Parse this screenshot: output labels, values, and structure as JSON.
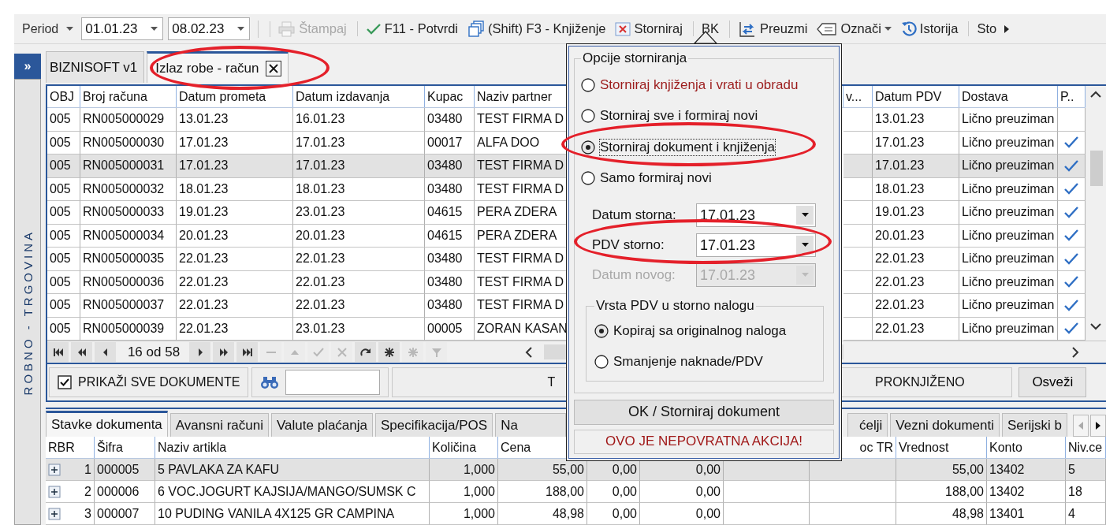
{
  "toolbar": {
    "period_label": "Period",
    "date_from": "01.01.23",
    "date_to": "08.02.23",
    "buttons": [
      {
        "kind": "print",
        "label": "Štampaj",
        "disabled": true,
        "separator_before": true,
        "dropdown": false
      },
      {
        "kind": "check",
        "label": "F11 - Potvrdi",
        "disabled": false,
        "separator_before": true,
        "dropdown": false
      },
      {
        "kind": "copy",
        "label": "(Shift) F3 - Knjiženje",
        "disabled": false,
        "separator_before": false,
        "dropdown": false
      },
      {
        "kind": "cancel",
        "label": "Storniraj",
        "disabled": false,
        "separator_before": false,
        "dropdown": false
      },
      {
        "kind": "text",
        "label": "BK",
        "disabled": false,
        "separator_before": true,
        "dropdown": false
      },
      {
        "kind": "download",
        "label": "Preuzmi",
        "disabled": false,
        "separator_before": true,
        "dropdown": false
      },
      {
        "kind": "tag",
        "label": "Označi",
        "disabled": false,
        "separator_before": false,
        "dropdown": true
      },
      {
        "kind": "history",
        "label": "Istorija",
        "disabled": false,
        "separator_before": false,
        "dropdown": false
      },
      {
        "kind": "text",
        "label": "Sto",
        "disabled": false,
        "separator_before": true,
        "dropdown": false
      }
    ]
  },
  "side_panel": {
    "expand_button": "»",
    "label": "ROBNO - TRGOVINA"
  },
  "tabs": [
    {
      "label": "BIZNISOFT v1",
      "selected": false,
      "closable": false
    },
    {
      "label": "Izlaz robe - račun",
      "selected": true,
      "closable": true
    }
  ],
  "documents_table": {
    "columns": [
      "OBJ",
      "Broj računa",
      "Datum prometa",
      "Datum izdavanja",
      "Kupac",
      "Naziv partner",
      null,
      "v...",
      "Datum PDV",
      "Dostava",
      "P.."
    ],
    "rows": [
      {
        "cells": [
          "005",
          "RN005000029",
          "13.01.23",
          "16.01.23",
          "03480",
          "TEST FIRMA D",
          null,
          null,
          "13.01.23",
          "Lično preuziman"
        ],
        "posted": false,
        "selected": false
      },
      {
        "cells": [
          "005",
          "RN005000030",
          "17.01.23",
          "17.01.23",
          "00017",
          "ALFA DOO",
          null,
          null,
          "17.01.23",
          "Lično preuziman"
        ],
        "posted": true,
        "selected": false
      },
      {
        "cells": [
          "005",
          "RN005000031",
          "17.01.23",
          "17.01.23",
          "03480",
          "TEST FIRMA D",
          null,
          null,
          "17.01.23",
          "Lično preuziman"
        ],
        "posted": true,
        "selected": true
      },
      {
        "cells": [
          "005",
          "RN005000032",
          "18.01.23",
          "18.01.23",
          "03480",
          "TEST FIRMA D",
          null,
          null,
          "18.01.23",
          "Lično preuziman"
        ],
        "posted": true,
        "selected": false
      },
      {
        "cells": [
          "005",
          "RN005000033",
          "19.01.23",
          "23.01.23",
          "04615",
          "PERA ZDERA",
          null,
          null,
          "19.01.23",
          "Lično preuziman"
        ],
        "posted": true,
        "selected": false
      },
      {
        "cells": [
          "005",
          "RN005000034",
          "20.01.23",
          "20.01.23",
          "04615",
          "PERA ZDERA",
          null,
          null,
          "20.01.23",
          "Lično preuziman"
        ],
        "posted": true,
        "selected": false
      },
      {
        "cells": [
          "005",
          "RN005000035",
          "22.01.23",
          "22.01.23",
          "03480",
          "TEST FIRMA D",
          null,
          null,
          "22.01.23",
          "Lično preuziman"
        ],
        "posted": true,
        "selected": false
      },
      {
        "cells": [
          "005",
          "RN005000036",
          "22.01.23",
          "22.01.23",
          "03480",
          "TEST FIRMA D",
          null,
          null,
          "22.01.23",
          "Lično preuziman"
        ],
        "posted": true,
        "selected": false
      },
      {
        "cells": [
          "005",
          "RN005000037",
          "22.01.23",
          "22.01.23",
          "03480",
          "TEST FIRMA D",
          null,
          null,
          "22.01.23",
          "Lično preuziman"
        ],
        "posted": true,
        "selected": false
      },
      {
        "cells": [
          "005",
          "RN005000039",
          "22.01.23",
          "23.01.23",
          "00005",
          "ZORAN KASAN",
          null,
          null,
          "22.01.23",
          "Lično preuziman"
        ],
        "posted": true,
        "selected": false
      }
    ]
  },
  "navigator": {
    "buttons_left": [
      {
        "kind": "first",
        "disabled": false
      },
      {
        "kind": "page-back",
        "disabled": false
      },
      {
        "kind": "previous",
        "disabled": false
      }
    ],
    "position": "16 od 58",
    "buttons_right": [
      {
        "kind": "next",
        "disabled": false
      },
      {
        "kind": "page-forward",
        "disabled": false
      },
      {
        "kind": "last",
        "disabled": false
      },
      {
        "kind": "delete",
        "disabled": true
      },
      {
        "kind": "up",
        "disabled": true
      },
      {
        "kind": "post",
        "disabled": true
      },
      {
        "kind": "cancel",
        "disabled": true
      },
      {
        "kind": "refresh",
        "disabled": false
      },
      {
        "kind": "add",
        "disabled": false
      },
      {
        "kind": "add",
        "disabled": true
      },
      {
        "kind": "filter",
        "disabled": true
      }
    ]
  },
  "filter_bar": {
    "show_all": {
      "label": "PRIKAŽI SVE DOKUMENTE",
      "checked": true
    },
    "status_left": "T",
    "status_right": "PROKNJIŽENO",
    "refresh_button": "Osveži"
  },
  "detail_tabs": [
    {
      "label": "Stavke dokumenta",
      "selected": true
    },
    {
      "label": "Avansni računi",
      "selected": false
    },
    {
      "label": "Valute plaćanja",
      "selected": false
    },
    {
      "label": "Specifikacija/POS",
      "selected": false
    },
    {
      "label": "Na",
      "selected": false
    },
    {
      "label": "ćelji",
      "selected": false
    },
    {
      "label": "Vezni dokumenti",
      "selected": false
    },
    {
      "label": "Serijski b",
      "selected": false
    }
  ],
  "items_table": {
    "columns": [
      "RBR",
      "Šifra",
      "Naziv artikla",
      "Količina",
      "Cena",
      null,
      null,
      null,
      "oc TR",
      "Vrednost",
      "Konto",
      "Niv.ce"
    ],
    "rows": [
      {
        "cells": [
          "1",
          "000005",
          "5 PAVLAKA ZA KAFU",
          "1,000",
          "55,00",
          "0,00",
          "0,00",
          null,
          null,
          "55,00",
          "13402",
          "5"
        ],
        "selected": true
      },
      {
        "cells": [
          "2",
          "000006",
          "6 VOC.JOGURT KAJSIJA/MANGO/SUMSK C",
          "1,000",
          "188,00",
          "0,00",
          "0,00",
          null,
          null,
          "188,00",
          "13402",
          "18"
        ],
        "selected": false
      },
      {
        "cells": [
          "3",
          "000007",
          "10 PUDING VANILA 4X125 GR CAMPINA",
          "1,000",
          "48,98",
          "0,00",
          "0,00",
          null,
          null,
          "48,98",
          "13401",
          "4"
        ],
        "selected": false
      }
    ]
  },
  "storno_popup": {
    "title": "Opcije storniranja",
    "options": [
      {
        "label": "Storniraj knjiženja i vrati u obradu",
        "selected": false,
        "danger": true
      },
      {
        "label": "Storniraj sve i formiraj novi",
        "selected": false,
        "danger": false
      },
      {
        "label": "Storniraj dokument i knjiženja",
        "selected": true,
        "danger": false
      },
      {
        "label": "Samo formiraj novi",
        "selected": false,
        "danger": false
      }
    ],
    "fields": [
      {
        "label": "Datum storna:",
        "value": "17.01.23",
        "disabled": false
      },
      {
        "label": "PDV storno:",
        "value": "17.01.23",
        "disabled": false
      },
      {
        "label": "Datum novog:",
        "value": "17.01.23",
        "disabled": true
      }
    ],
    "vat_group": {
      "title": "Vrsta PDV u storno nalogu",
      "options": [
        {
          "label": "Kopiraj sa originalnog naloga",
          "selected": true
        },
        {
          "label": "Smanjenje naknade/PDV",
          "selected": false
        }
      ]
    },
    "confirm_button": "OK / Storniraj dokument",
    "warning": "OVO JE NEPOVRATNA AKCIJA!"
  }
}
